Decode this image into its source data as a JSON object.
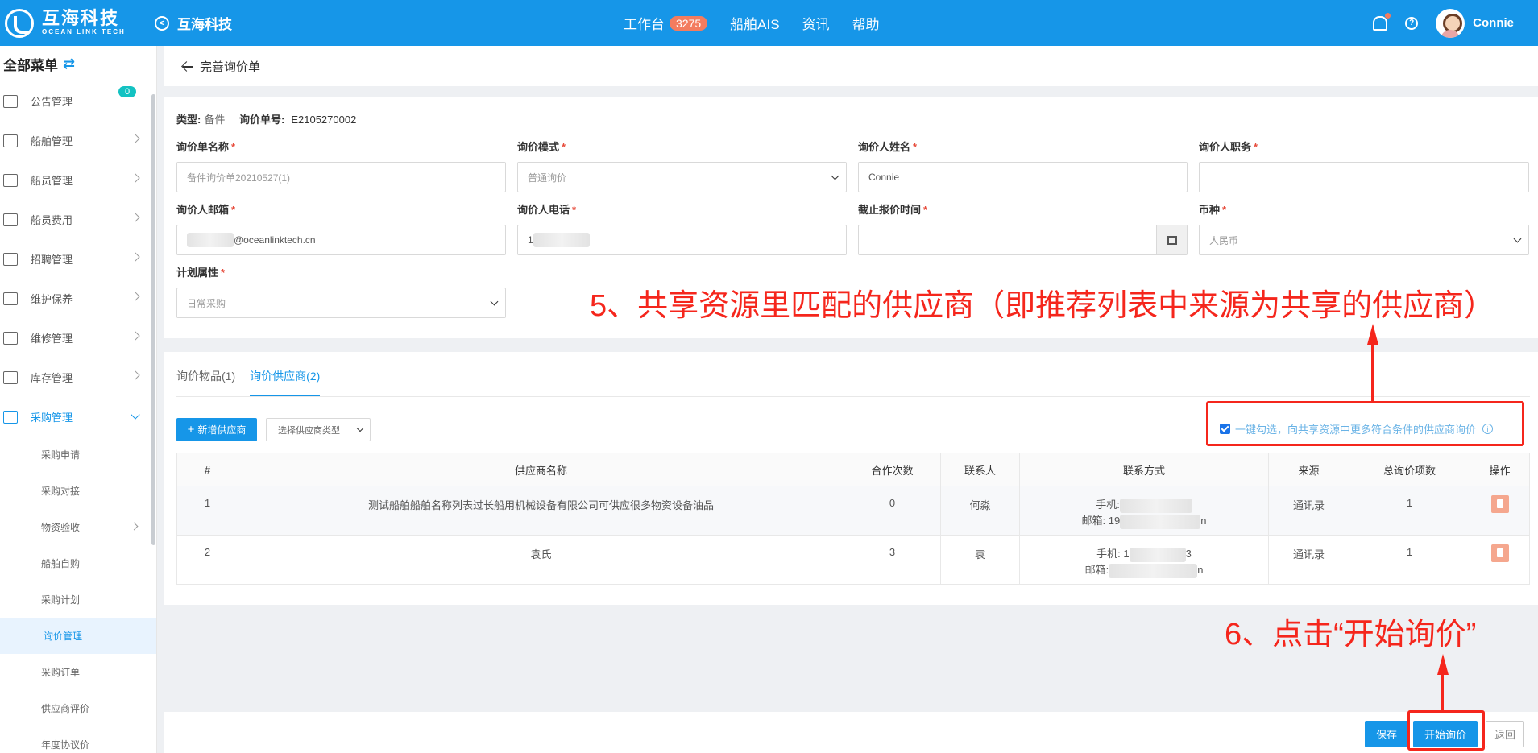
{
  "topbar": {
    "logo_cn": "互海科技",
    "logo_en": "OCEAN LINK TECH",
    "brand": "互海科技",
    "nav": [
      {
        "label": "工作台",
        "badge": "3275"
      },
      {
        "label": "船舶AIS"
      },
      {
        "label": "资讯"
      },
      {
        "label": "帮助"
      }
    ],
    "username": "Connie"
  },
  "sidebar": {
    "title": "全部菜单",
    "items": [
      {
        "label": "公告管理",
        "icon": "book-icon",
        "badge": "0"
      },
      {
        "label": "船舶管理",
        "icon": "anchor-icon"
      },
      {
        "label": "船员管理",
        "icon": "user-icon"
      },
      {
        "label": "船员费用",
        "icon": "wallet-icon"
      },
      {
        "label": "招聘管理",
        "icon": "recruit-icon"
      },
      {
        "label": "维护保养",
        "icon": "tool-icon"
      },
      {
        "label": "维修管理",
        "icon": "wrench-icon"
      },
      {
        "label": "库存管理",
        "icon": "home-icon"
      },
      {
        "label": "采购管理",
        "icon": "cart-icon"
      }
    ],
    "subitems": [
      "采购申请",
      "采购对接",
      "物资验收",
      "船舶自购",
      "采购计划",
      "询价管理",
      "采购订单",
      "供应商评价",
      "年度协议价"
    ]
  },
  "page": {
    "title": "完善询价单",
    "meta": {
      "type_label": "类型:",
      "type_value": "备件",
      "no_label": "询价单号:",
      "no_value": "E2105270002"
    }
  },
  "form": {
    "name": {
      "label": "询价单名称",
      "value": "备件询价单20210527(1)"
    },
    "mode": {
      "label": "询价模式",
      "value": "普通询价"
    },
    "person": {
      "label": "询价人姓名",
      "value": "Connie"
    },
    "position": {
      "label": "询价人职务",
      "value": ""
    },
    "email": {
      "label": "询价人邮箱",
      "value": "@oceanlinktech.cn"
    },
    "phone": {
      "label": "询价人电话",
      "value": "1"
    },
    "deadline": {
      "label": "截止报价时间",
      "value": ""
    },
    "currency": {
      "label": "币种",
      "value": "人民币"
    },
    "plan": {
      "label": "计划属性",
      "value": "日常采购"
    }
  },
  "tabs": [
    "询价物品(1)",
    "询价供应商(2)"
  ],
  "supplier": {
    "add_label": "新增供应商",
    "type_placeholder": "选择供应商类型",
    "auto_label": "一键勾选，向共享资源中更多符合条件的供应商询价",
    "columns": [
      "#",
      "供应商名称",
      "合作次数",
      "联系人",
      "联系方式",
      "来源",
      "总询价项数",
      "操作"
    ],
    "rows": [
      {
        "no": "1",
        "name": "测试船舶船舶名称列表过长船用机械设备有限公司可供应很多物资设备油品",
        "times": "0",
        "contact": "何淼",
        "phone": "手机:",
        "phone_tail": "",
        "mail": "邮箱: 19",
        "mail_tail": "n",
        "source": "通讯录",
        "items": "1"
      },
      {
        "no": "2",
        "name": "袁氏",
        "times": "3",
        "contact": "袁",
        "phone": "手机: 1",
        "phone_tail": "3",
        "mail": "邮箱:",
        "mail_tail": "n",
        "source": "通讯录",
        "items": "1"
      }
    ]
  },
  "buttons": {
    "save": "保存",
    "start": "开始询价",
    "back": "返回"
  },
  "annotations": {
    "step5": "5、共享资源里匹配的供应商（即推荐列表中来源为共享的供应商）",
    "step6": "6、点击“开始询价”"
  }
}
